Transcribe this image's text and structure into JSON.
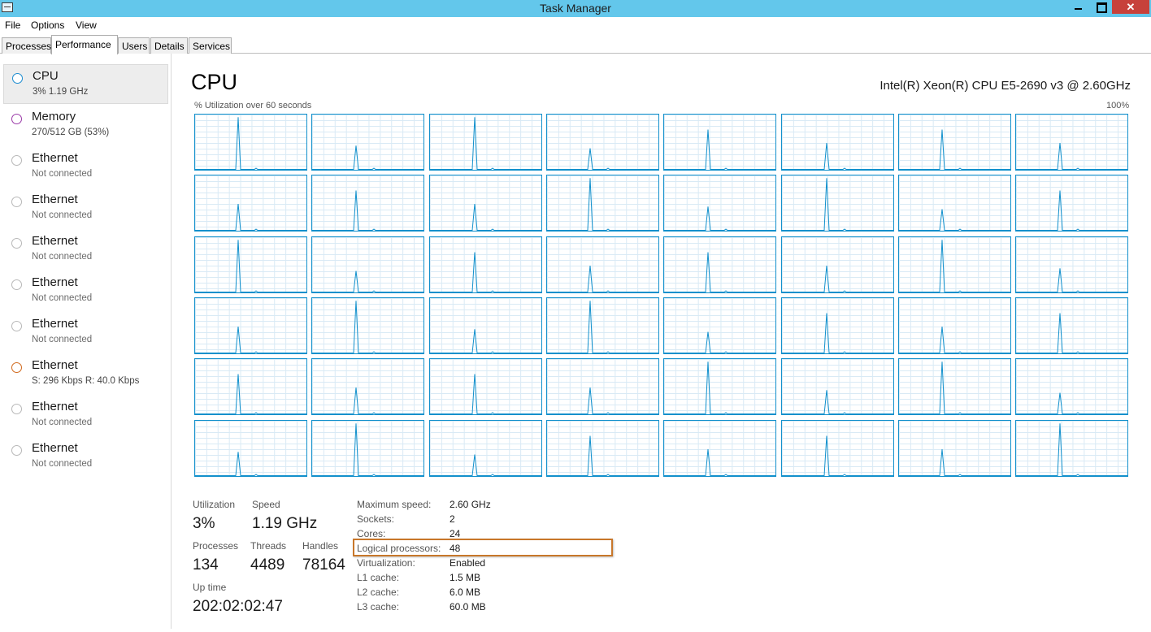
{
  "window": {
    "title": "Task Manager",
    "close_glyph": "✕"
  },
  "menu": [
    "File",
    "Options",
    "View"
  ],
  "tabs": [
    "Processes",
    "Performance",
    "Users",
    "Details",
    "Services"
  ],
  "active_tab": "Performance",
  "sidebar": {
    "items": [
      {
        "name": "CPU",
        "sub": "3%  1.19 GHz",
        "color": "#1c8cd0"
      },
      {
        "name": "Memory",
        "sub": "270/512 GB (53%)",
        "color": "#9b3ba8"
      },
      {
        "name": "Ethernet",
        "sub": "Not connected",
        "color": "#b8b8b8"
      },
      {
        "name": "Ethernet",
        "sub": "Not connected",
        "color": "#b8b8b8"
      },
      {
        "name": "Ethernet",
        "sub": "Not connected",
        "color": "#b8b8b8"
      },
      {
        "name": "Ethernet",
        "sub": "Not connected",
        "color": "#b8b8b8"
      },
      {
        "name": "Ethernet",
        "sub": "Not connected",
        "color": "#b8b8b8"
      },
      {
        "name": "Ethernet",
        "sub": "S: 296 Kbps  R: 40.0 Kbps",
        "color": "#d16a1e"
      },
      {
        "name": "Ethernet",
        "sub": "Not connected",
        "color": "#b8b8b8"
      },
      {
        "name": "Ethernet",
        "sub": "Not connected",
        "color": "#b8b8b8"
      }
    ]
  },
  "main": {
    "title": "CPU",
    "cpu_model": "Intel(R) Xeon(R) CPU E5-2690 v3 @ 2.60GHz",
    "graph_label": "% Utilization over 60 seconds",
    "graph_max": "100%",
    "line_color": "#1190cc",
    "logical_processor_count": 48
  },
  "stats": {
    "utilization_label": "Utilization",
    "utilization": "3%",
    "speed_label": "Speed",
    "speed": "1.19 GHz",
    "processes_label": "Processes",
    "processes": "134",
    "threads_label": "Threads",
    "threads": "4489",
    "handles_label": "Handles",
    "handles": "78164",
    "uptime_label": "Up time",
    "uptime": "202:02:02:47"
  },
  "details": [
    {
      "label": "Maximum speed:",
      "value": "2.60 GHz"
    },
    {
      "label": "Sockets:",
      "value": "2"
    },
    {
      "label": "Cores:",
      "value": "24"
    },
    {
      "label": "Logical processors:",
      "value": "48"
    },
    {
      "label": "Virtualization:",
      "value": "Enabled"
    },
    {
      "label": "L1 cache:",
      "value": "1.5 MB"
    },
    {
      "label": "L2 cache:",
      "value": "6.0 MB"
    },
    {
      "label": "L3 cache:",
      "value": "60.0 MB"
    }
  ],
  "highlighted_detail": "Logical processors:"
}
